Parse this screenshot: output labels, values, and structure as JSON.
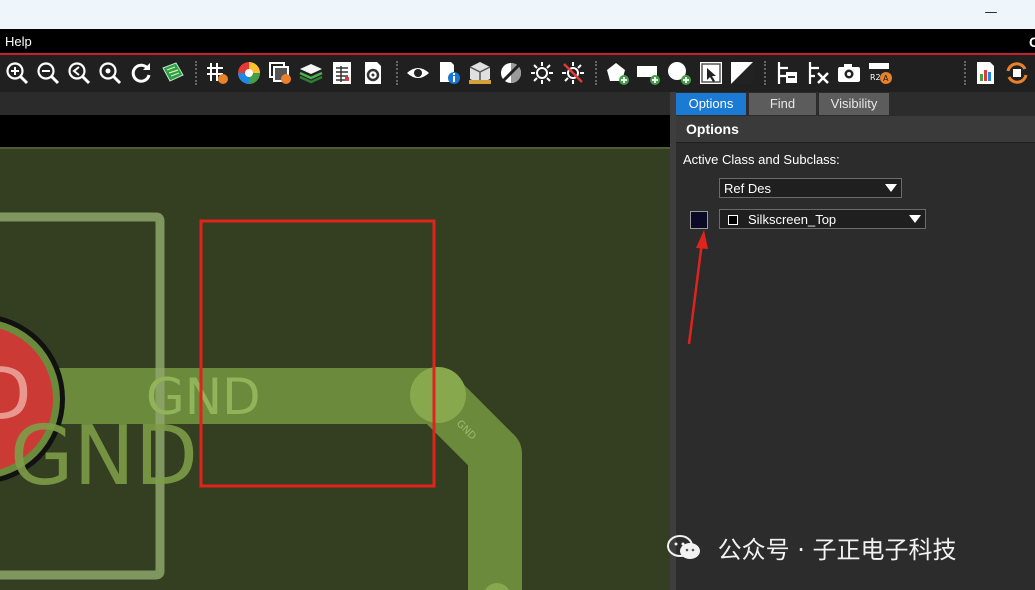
{
  "window": {
    "minimize_glyph": "—"
  },
  "menu": {
    "items": [
      "Help"
    ],
    "edge_glyph": "C"
  },
  "toolbar": {
    "icons": [
      "zoom-in-icon",
      "zoom-out-icon",
      "zoom-previous-icon",
      "zoom-fit-icon",
      "refresh-icon",
      "board-3d-icon",
      "grid-toggle-icon",
      "color-wheel-icon",
      "layer-stack-icon",
      "layers-icon",
      "spreadsheet-icon",
      "settings-doc-icon",
      "visibility-eye-icon",
      "info-doc-icon",
      "package-3d-icon",
      "shading-toggle-icon",
      "highlight-sun-icon",
      "dehighlight-sun-icon",
      "add-shape-icon",
      "add-rect-icon",
      "add-circle-icon",
      "select-cursor-icon",
      "split-shape-icon",
      "assign-net-icon",
      "unassign-net-icon",
      "camera-snapshot-icon",
      "rename-refdes-icon",
      "report-chart-icon",
      "refresh-sync-icon"
    ]
  },
  "canvas": {
    "net_label": "GND",
    "pad_fragment": "D",
    "trace_label": "GND",
    "colors": {
      "board": "#333f20",
      "trace": "#6b8a3c",
      "pad": "#cc3a36",
      "highlight_box": "#e0231d"
    }
  },
  "panel": {
    "tabs": [
      {
        "label": "Options",
        "active": true
      },
      {
        "label": "Find",
        "active": false
      },
      {
        "label": "Visibility",
        "active": false
      }
    ],
    "title": "Options",
    "active_class_label": "Active Class and Subclass:",
    "class_value": "Ref Des",
    "subclass_value": "Silkscreen_Top",
    "color_chip": "#0a0a26"
  },
  "watermark": {
    "text": "公众号 · 子正电子科技"
  }
}
